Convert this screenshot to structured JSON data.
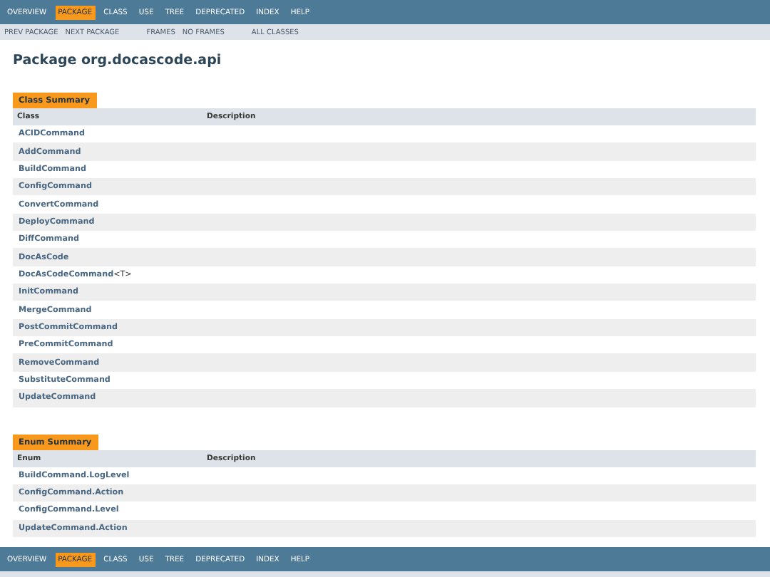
{
  "top_nav": {
    "items": [
      {
        "label": "OVERVIEW",
        "selected": false
      },
      {
        "label": "PACKAGE",
        "selected": true
      },
      {
        "label": "CLASS",
        "selected": false
      },
      {
        "label": "USE",
        "selected": false
      },
      {
        "label": "TREE",
        "selected": false
      },
      {
        "label": "DEPRECATED",
        "selected": false
      },
      {
        "label": "INDEX",
        "selected": false
      },
      {
        "label": "HELP",
        "selected": false
      }
    ]
  },
  "sub_nav": {
    "groups": [
      [
        "PREV PACKAGE",
        "NEXT PACKAGE"
      ],
      [
        "FRAMES",
        "NO FRAMES"
      ],
      [
        "ALL CLASSES"
      ]
    ]
  },
  "title": "Package org.docascode.api",
  "tables": [
    {
      "caption": "Class Summary",
      "columns": [
        "Class",
        "Description"
      ],
      "rows": [
        {
          "name": "ACIDCommand"
        },
        {
          "name": "AddCommand"
        },
        {
          "name": "BuildCommand"
        },
        {
          "name": "ConfigCommand"
        },
        {
          "name": "ConvertCommand"
        },
        {
          "name": "DeployCommand"
        },
        {
          "name": "DiffCommand"
        },
        {
          "name": "DocAsCode"
        },
        {
          "name": "DocAsCodeCommand",
          "type_params": "<T>"
        },
        {
          "name": "InitCommand"
        },
        {
          "name": "MergeCommand"
        },
        {
          "name": "PostCommitCommand"
        },
        {
          "name": "PreCommitCommand"
        },
        {
          "name": "RemoveCommand"
        },
        {
          "name": "SubstituteCommand"
        },
        {
          "name": "UpdateCommand"
        }
      ]
    },
    {
      "caption": "Enum Summary",
      "columns": [
        "Enum",
        "Description"
      ],
      "rows": [
        {
          "name": "BuildCommand.LogLevel"
        },
        {
          "name": "ConfigCommand.Action"
        },
        {
          "name": "ConfigCommand.Level"
        },
        {
          "name": "UpdateCommand.Action"
        }
      ]
    }
  ],
  "bottom_nav": {
    "items": [
      {
        "label": "OVERVIEW",
        "selected": false
      },
      {
        "label": "PACKAGE",
        "selected": true
      },
      {
        "label": "CLASS",
        "selected": false
      },
      {
        "label": "USE",
        "selected": false
      },
      {
        "label": "TREE",
        "selected": false
      },
      {
        "label": "DEPRECATED",
        "selected": false
      },
      {
        "label": "INDEX",
        "selected": false
      },
      {
        "label": "HELP",
        "selected": false
      }
    ]
  }
}
